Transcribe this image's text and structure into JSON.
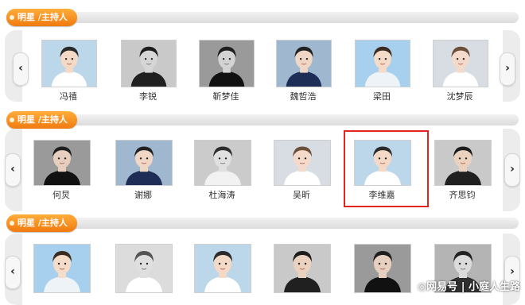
{
  "section_label": "明星 /主持人",
  "rows": [
    {
      "names": [
        "冯禧",
        "李锐",
        "靳梦佳",
        "魏哲浩",
        "梁田",
        "沈梦辰"
      ]
    },
    {
      "names": [
        "何炅",
        "谢娜",
        "杜海涛",
        "吴昕",
        "李维嘉",
        "齐思钧"
      ]
    },
    {
      "names": [
        "",
        "",
        "",
        "",
        "",
        ""
      ]
    }
  ],
  "nav": {
    "prev": "‹",
    "next": "›"
  },
  "watermark": "◎网易号 | 小庭人生路",
  "colors": {
    "tag": "#f58d1e",
    "highlight": "#e2241d"
  }
}
